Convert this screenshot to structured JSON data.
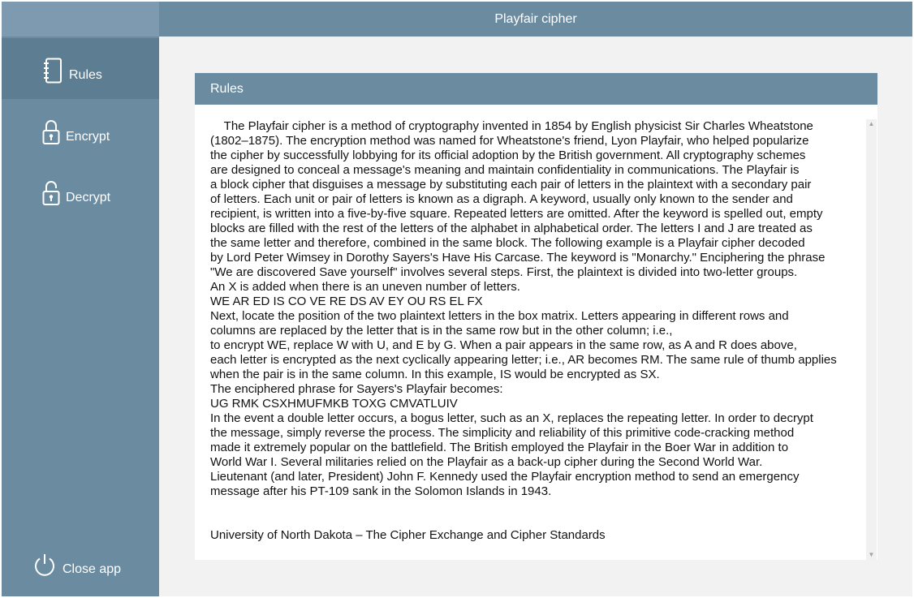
{
  "window": {
    "title": "Playfair cipher"
  },
  "sidebar": {
    "items": [
      {
        "label": "Rules",
        "icon": "notebook-icon",
        "active": true
      },
      {
        "label": "Encrypt",
        "icon": "lock-icon"
      },
      {
        "label": "Decrypt",
        "icon": "unlock-icon"
      }
    ],
    "close_label": "Close app"
  },
  "panel": {
    "title": "Rules",
    "body": "    The Playfair cipher is a method of cryptography invented in 1854 by English physicist Sir Charles Wheatstone\n(1802–1875). The encryption method was named for Wheatstone's friend, Lyon Playfair, who helped popularize\nthe cipher by successfully lobbying for its official adoption by the British government. All cryptography schemes\nare designed to conceal a message's meaning and maintain confidentiality in communications. The Playfair is\na block cipher that disguises a message by substituting each pair of letters in the plaintext with a secondary pair\nof letters. Each unit or pair of letters is known as a digraph. A keyword, usually only known to the sender and\nrecipient, is written into a five-by-five square. Repeated letters are omitted. After the keyword is spelled out, empty\nblocks are filled with the rest of the letters of the alphabet in alphabetical order. The letters I and J are treated as\nthe same letter and therefore, combined in the same block. The following example is a Playfair cipher decoded\nby Lord Peter Wimsey in Dorothy Sayers's Have His Carcase. The keyword is \"Monarchy.\" Enciphering the phrase\n\"We are discovered Save yourself\" involves several steps. First, the plaintext is divided into two-letter groups.\nAn X is added when there is an uneven number of letters.\nWE AR ED IS CO VE RE DS AV EY OU RS EL FX\nNext, locate the position of the two plaintext letters in the box matrix. Letters appearing in different rows and\ncolumns are replaced by the letter that is in the same row but in the other column; i.e.,\nto encrypt WE, replace W with U, and E by G. When a pair appears in the same row, as A and R does above,\neach letter is encrypted as the next cyclically appearing letter; i.e., AR becomes RM. The same rule of thumb applies\nwhen the pair is in the same column. In this example, IS would be encrypted as SX.\nThe enciphered phrase for Sayers's Playfair becomes:\nUG RMK CSXHMUFMKB TOXG CMVATLUIV\nIn the event a double letter occurs, a bogus letter, such as an X, replaces the repeating letter. In order to decrypt\nthe message, simply reverse the process. The simplicity and reliability of this primitive code-cracking method\nmade it extremely popular on the battlefield. The British employed the Playfair in the Boer War in addition to\nWorld War I. Several militaries relied on the Playfair as a back-up cipher during the Second World War.\nLieutenant (and later, President) John F. Kennedy used the Playfair encryption method to send an emergency\nmessage after his PT-109 sank in the Solomon Islands in 1943.",
    "source": "University of North Dakota – The Cipher Exchange and Cipher Standards"
  },
  "colors": {
    "sidebar": "#6b8ba0",
    "sidebar_active": "#5d7d92",
    "header": "#6b8ba0",
    "background": "#f2f2f2"
  }
}
